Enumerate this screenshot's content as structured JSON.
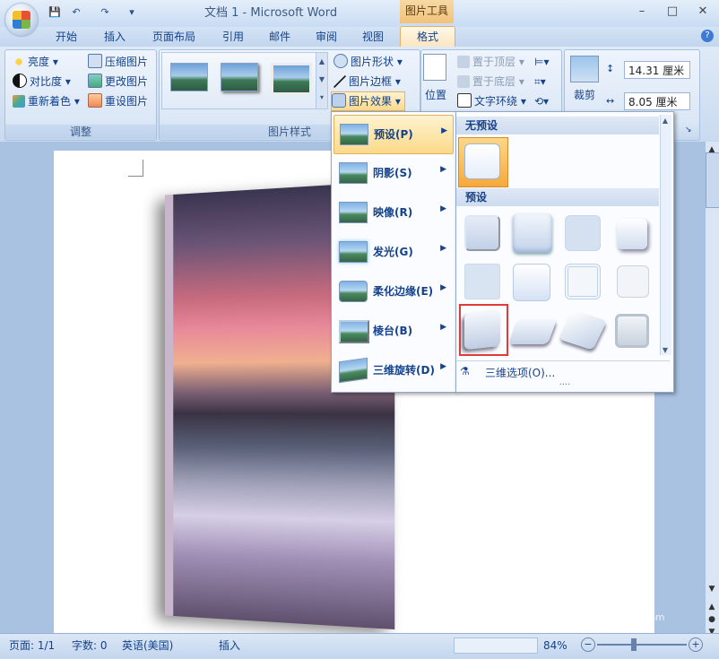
{
  "window": {
    "title": "文档 1 - Microsoft Word",
    "context_tab_group": "图片工具",
    "controls": {
      "minimize": "–",
      "restore": "□",
      "close": "✕"
    }
  },
  "quick_access": {
    "save_icon": "save-icon",
    "undo_icon": "undo-icon",
    "redo_icon": "redo-icon",
    "customize_icon": "▾"
  },
  "tabs": [
    "开始",
    "插入",
    "页面布局",
    "引用",
    "邮件",
    "审阅",
    "视图",
    "格式"
  ],
  "active_tab": "格式",
  "help_icon": "?",
  "ribbon": {
    "adjust": {
      "label": "调整",
      "items": [
        {
          "label": "亮度 ▾",
          "icon": "brightness-icon"
        },
        {
          "label": "对比度 ▾",
          "icon": "contrast-icon"
        },
        {
          "label": "重新着色 ▾",
          "icon": "recolor-icon"
        },
        {
          "label": "压缩图片",
          "icon": "compress-icon"
        },
        {
          "label": "更改图片",
          "icon": "change-picture-icon"
        },
        {
          "label": "重设图片",
          "icon": "reset-picture-icon"
        }
      ]
    },
    "picture_styles": {
      "label": "图片样式",
      "shape": "图片形状 ▾",
      "border": "图片边框 ▾",
      "effects": "图片效果 ▾"
    },
    "arrange": {
      "position": "位置",
      "bring_front": "置于顶层 ▾",
      "send_back": "置于底层 ▾",
      "text_wrap": "文字环绕 ▾"
    },
    "size": {
      "crop": "裁剪",
      "height": "14.31 厘米",
      "width": "8.05 厘米"
    }
  },
  "effects_menu": [
    {
      "label": "预设(P)",
      "key": "P"
    },
    {
      "label": "阴影(S)",
      "key": "S"
    },
    {
      "label": "映像(R)",
      "key": "R"
    },
    {
      "label": "发光(G)",
      "key": "G"
    },
    {
      "label": "柔化边缘(E)",
      "key": "E"
    },
    {
      "label": "棱台(B)",
      "key": "B"
    },
    {
      "label": "三维旋转(D)",
      "key": "D"
    }
  ],
  "preset_panel": {
    "no_preset_header": "无预设",
    "preset_header": "预设",
    "three_d_options": "三维选项(O)...",
    "selected_preset_index": 8
  },
  "status_bar": {
    "page": "页面: 1/1",
    "words": "字数: 0",
    "language": "英语(美国)",
    "mode": "插入",
    "zoom": "84%"
  },
  "watermark": {
    "text": "Bai经验",
    "sub": "jingyan.baidu.com"
  },
  "colors": {
    "accent": "#15428b",
    "highlight": "#fbd98a",
    "selection_outline": "#e03b3b"
  }
}
